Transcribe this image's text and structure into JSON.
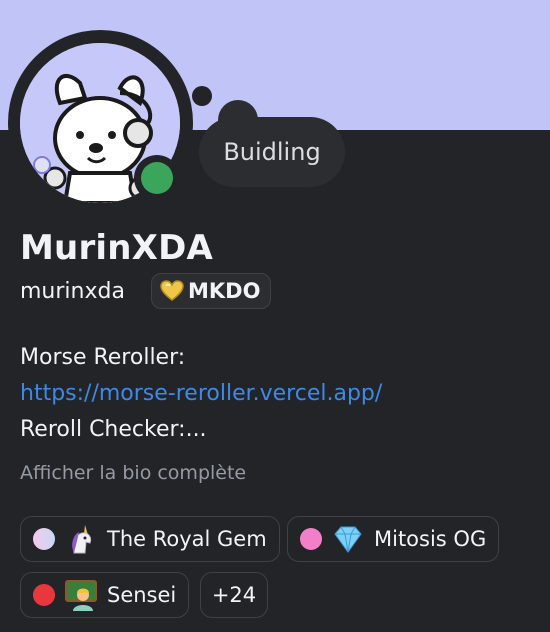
{
  "status": {
    "text": "Buidling"
  },
  "profile": {
    "display_name": "MurinXDA",
    "username": "murinxda",
    "clan_tag": "MKDO"
  },
  "bio": {
    "line1": "Morse Reroller:",
    "link": "https://morse-reroller.vercel.app/",
    "line3": "Reroll Checker:...",
    "show_more": "Afficher la bio complète"
  },
  "roles": [
    {
      "name": "The Royal Gem",
      "color": "#e5c2f2",
      "icon": "unicorn-icon"
    },
    {
      "name": "Mitosis OG",
      "color": "#f47fc9",
      "icon": "diamond-icon"
    },
    {
      "name": "Sensei",
      "color": "#e8383d",
      "icon": "teacher-icon"
    }
  ],
  "more_roles": "+24",
  "colors": {
    "banner": "#c0c4f7",
    "background": "#232428",
    "online": "#3ba55c",
    "link": "#3c89e8"
  }
}
